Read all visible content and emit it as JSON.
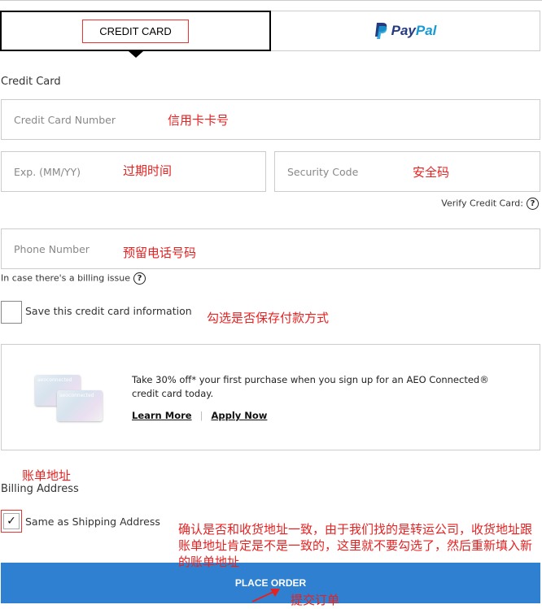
{
  "tabs": {
    "credit_card": "CREDIT CARD",
    "paypal_p1": "Pay",
    "paypal_p2": "Pal"
  },
  "section_title": "Credit Card",
  "fields": {
    "card_number": {
      "placeholder": "Credit Card Number",
      "note": "信用卡卡号"
    },
    "exp": {
      "placeholder": "Exp. (MM/YY)",
      "note": "过期时间"
    },
    "security": {
      "placeholder": "Security Code",
      "note": "安全码"
    },
    "verify": "Verify Credit Card:",
    "phone": {
      "placeholder": "Phone Number",
      "note": "预留电话号码"
    },
    "billing_issue": "In case there's a billing issue"
  },
  "save_card": {
    "label": "Save this credit card information",
    "checked": false,
    "note": "勾选是否保存付款方式"
  },
  "promo": {
    "card_brand": "aeoconnected",
    "text": "Take 30% off* your first purchase when you sign up for an AEO Connected® credit card today.",
    "learn_more": "Learn More",
    "separator": "|",
    "apply_now": "Apply Now"
  },
  "billing": {
    "note": "账单地址",
    "title": "Billing Address",
    "same_label": "Same as Shipping Address",
    "checked": true,
    "same_note": "确认是否和收货地址一致，由于我们找的是转运公司，收货地址跟账单地址肯定是不是一致的，这里就不要勾选了，然后重新填入新的账单地址"
  },
  "place_order": {
    "label": "PLACE ORDER",
    "note": "提交订单"
  },
  "colors": {
    "button": "#2f80d1",
    "annotation": "#e52222"
  }
}
